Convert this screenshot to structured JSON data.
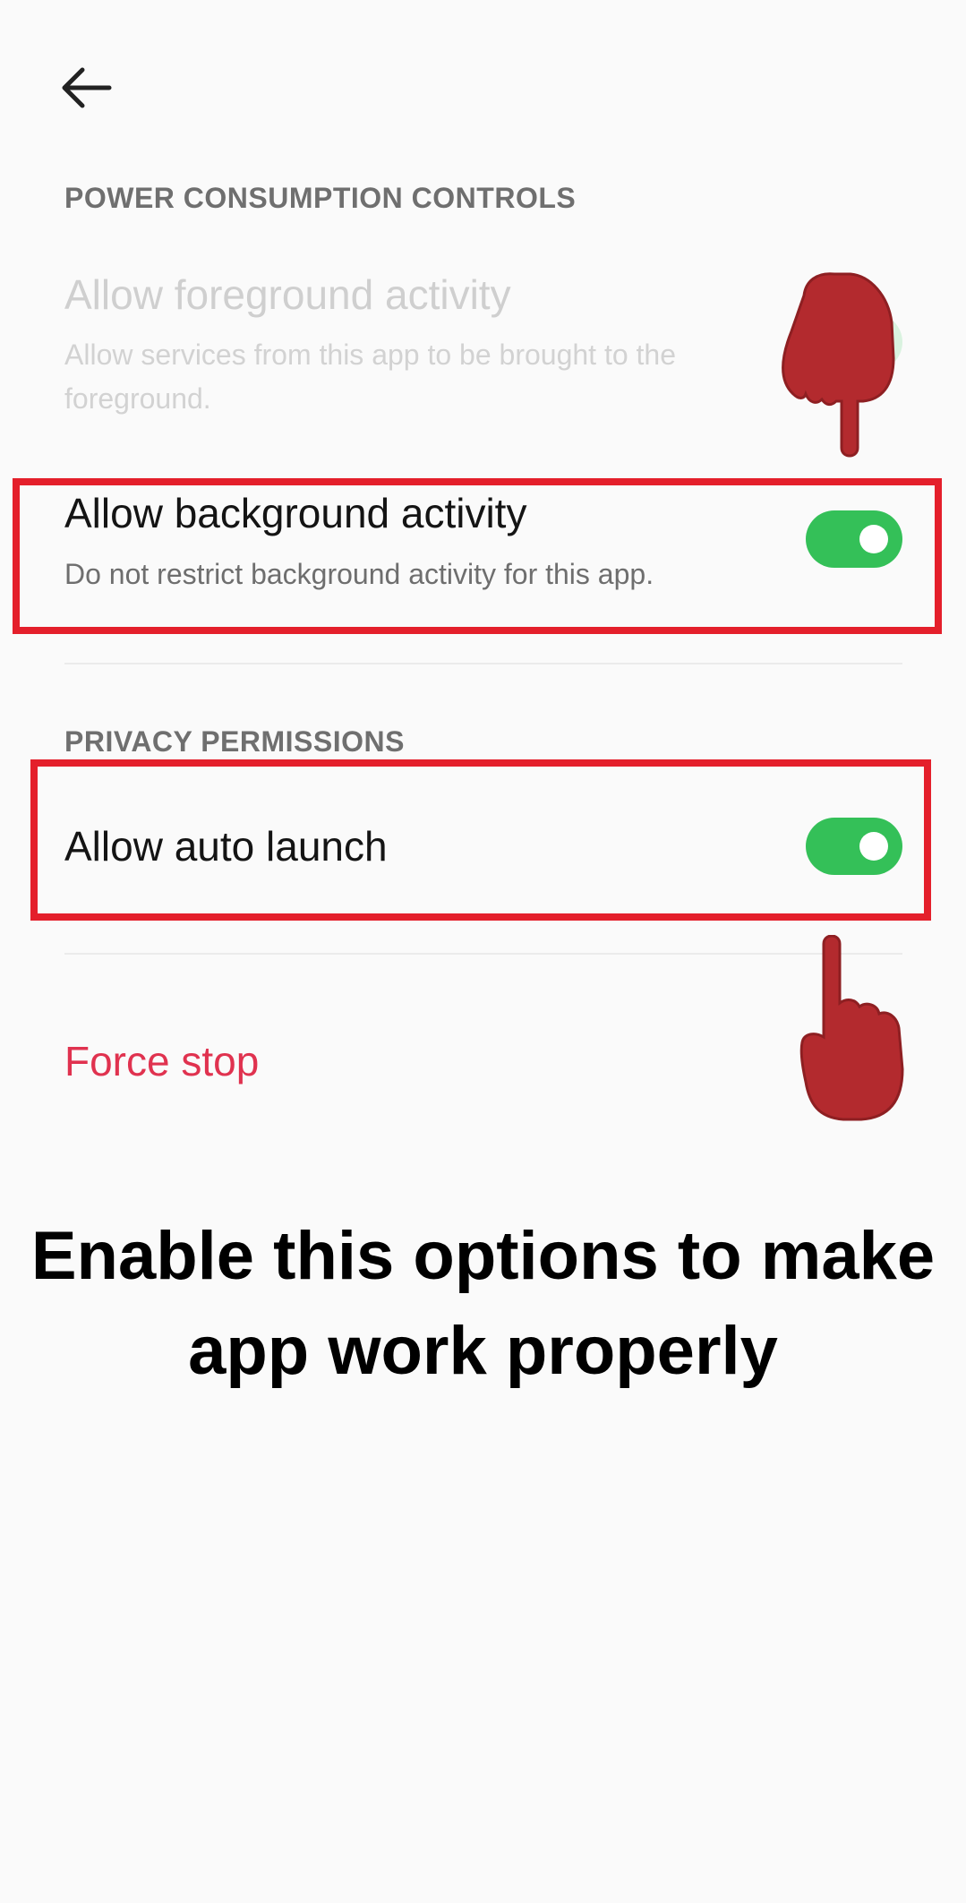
{
  "header": {
    "back_icon": "arrow-left-icon"
  },
  "power_section": {
    "title": "POWER CONSUMPTION CONTROLS",
    "foreground": {
      "title": "Allow foreground activity",
      "subtitle": "Allow services from this app to be brought to the foreground.",
      "enabled": false
    },
    "background": {
      "title": "Allow background activity",
      "subtitle": "Do not restrict background activity for this app.",
      "enabled": true
    }
  },
  "privacy_section": {
    "title": "PRIVACY PERMISSIONS",
    "auto_launch": {
      "title": "Allow auto launch",
      "enabled": true
    }
  },
  "force_stop": {
    "label": "Force stop"
  },
  "overlay": {
    "caption": "Enable this options to make app work properly",
    "pointer_icon": "pointing-hand-icon"
  },
  "colors": {
    "toggle_on": "#34c058",
    "highlight": "#e41f2b",
    "danger": "#e0324f",
    "hand": "#b32a2e"
  }
}
